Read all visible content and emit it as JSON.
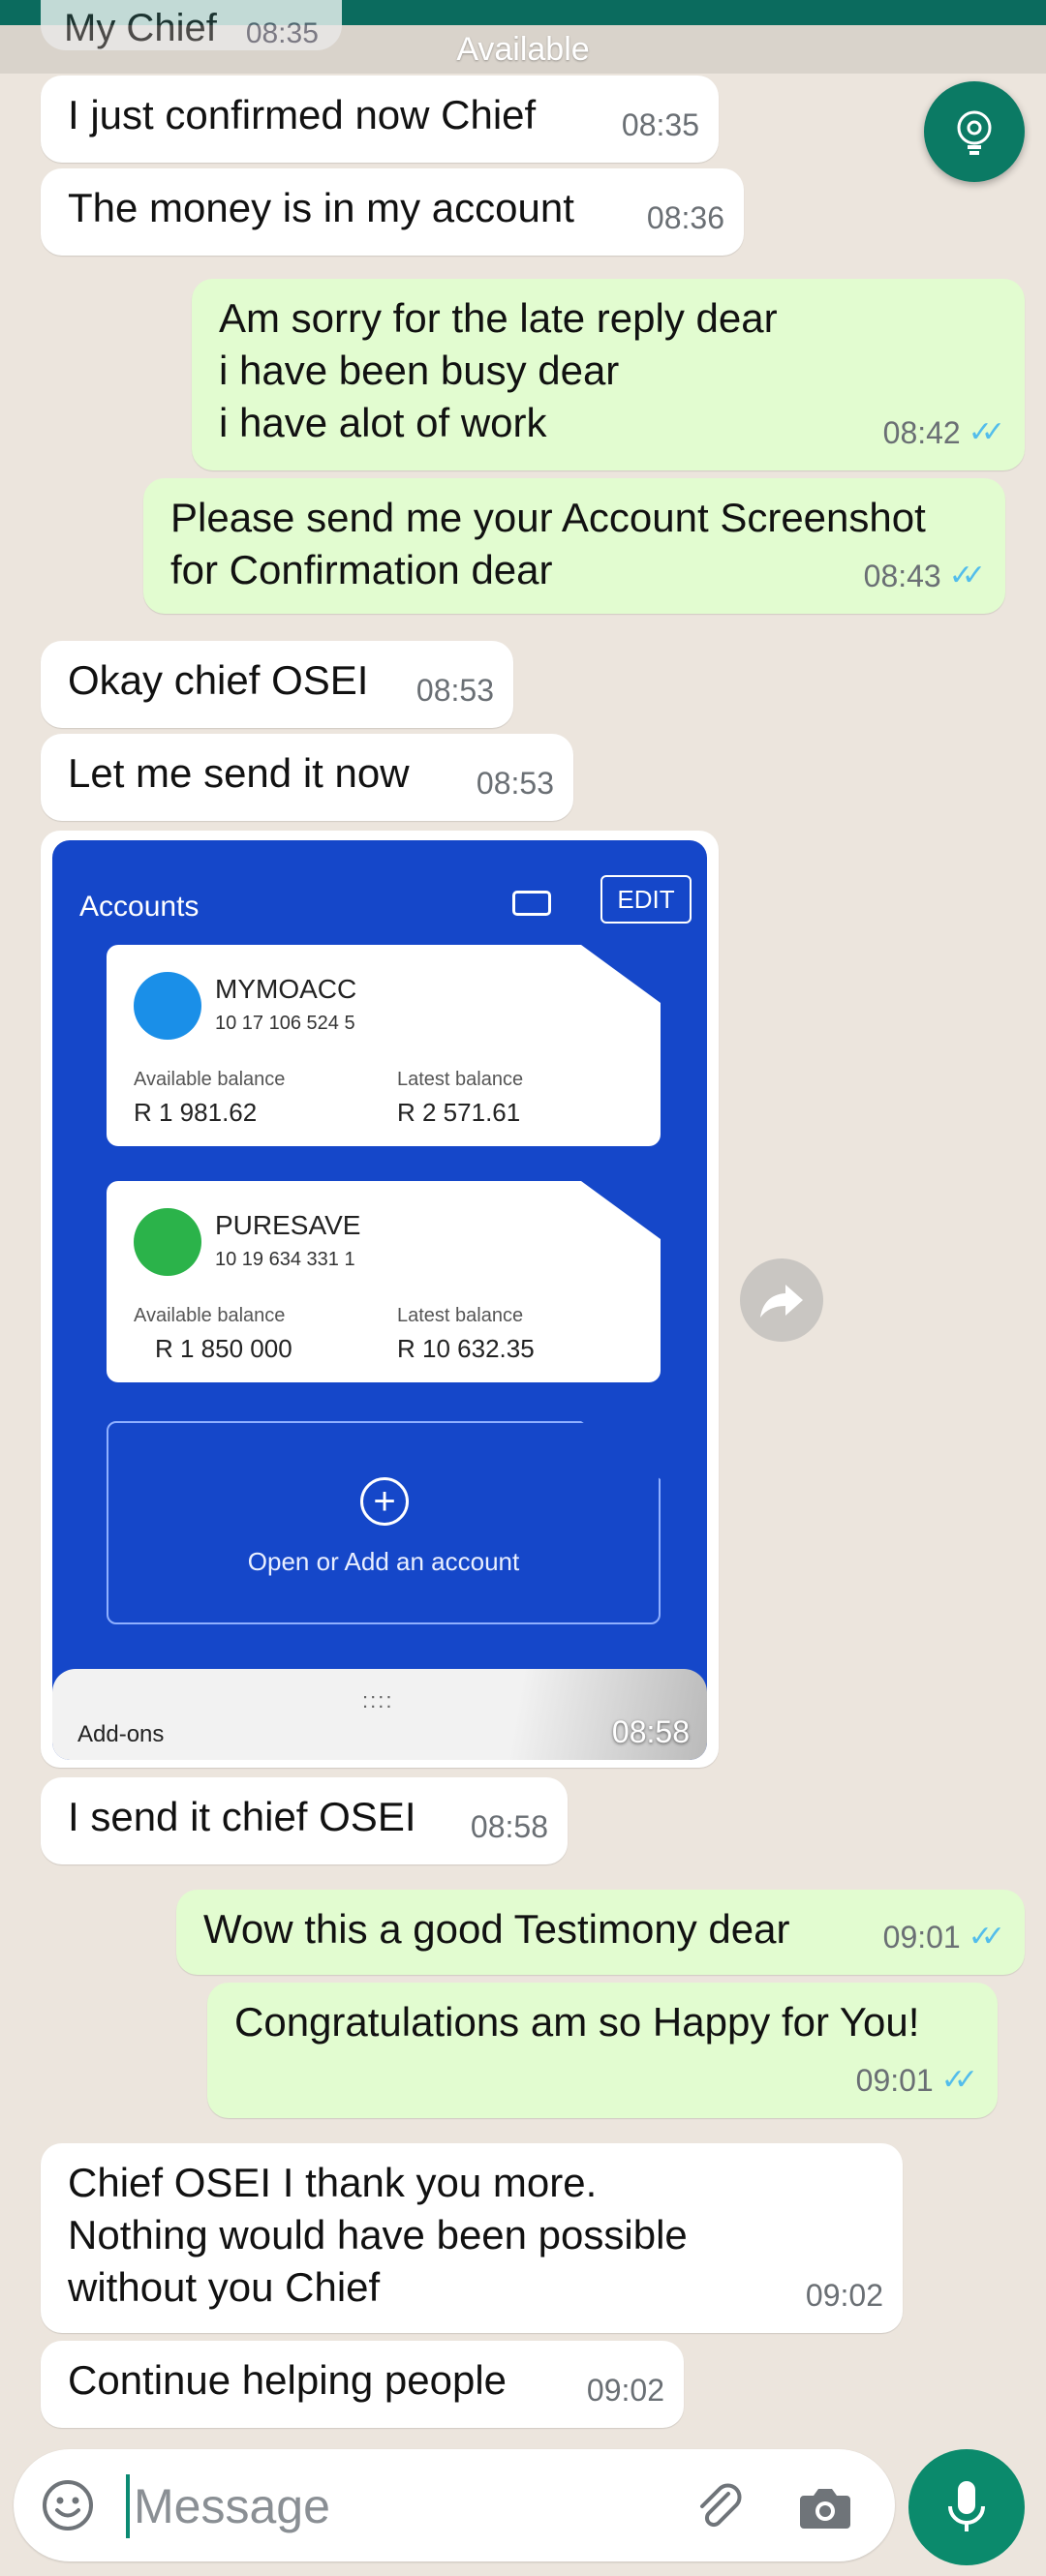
{
  "header": {
    "partial_name": "My Chief",
    "partial_time": "08:35",
    "status": "Available"
  },
  "messages": [
    {
      "dir": "in",
      "text": "I just confirmed now Chief",
      "time": "08:35"
    },
    {
      "dir": "in",
      "text": "The money is in my account",
      "time": "08:36"
    },
    {
      "dir": "out",
      "text": "Am sorry for the late reply dear\ni have been busy dear\ni have alot of work",
      "time": "08:42",
      "ticks": "✓✓"
    },
    {
      "dir": "out",
      "text": "Please send me your Account Screenshot\nfor Confirmation dear",
      "time": "08:43",
      "ticks": "✓✓"
    },
    {
      "dir": "in",
      "text": "Okay chief OSEI",
      "time": "08:53"
    },
    {
      "dir": "in",
      "text": "Let me send it now",
      "time": "08:53"
    },
    {
      "dir": "in",
      "text": "I send it chief OSEI",
      "time": "08:58"
    },
    {
      "dir": "out",
      "text": "Wow this a good Testimony dear",
      "time": "09:01",
      "ticks": "✓✓"
    },
    {
      "dir": "out",
      "text": "Congratulations am so Happy for You!",
      "time": "09:01",
      "ticks": "✓✓"
    },
    {
      "dir": "in",
      "text": "Chief OSEI I thank you more.\nNothing would have been possible\nwithout you Chief",
      "time": "09:02"
    },
    {
      "dir": "in",
      "text": "Continue helping people",
      "time": "09:02"
    }
  ],
  "image_message": {
    "time": "08:58",
    "screen": {
      "title": "Accounts",
      "edit_label": "EDIT",
      "accounts": [
        {
          "name": "MYMOACC",
          "number": "10 17 106 524 5",
          "avail_label": "Available balance",
          "avail": "R 1 981.62",
          "latest_label": "Latest balance",
          "latest": "R 2 571.61",
          "logo_color": "#1a8fe8"
        },
        {
          "name": "PURESAVE",
          "number": "10 19 634 331 1",
          "avail_label": "Available balance",
          "avail": "R 1 850 000",
          "latest_label": "Latest balance",
          "latest": "R 10 632.35",
          "logo_color": "#2bb34a"
        }
      ],
      "add_label": "Open or Add an account",
      "addons_label": "Add-ons",
      "dots": "::::"
    }
  },
  "composer": {
    "placeholder": "Message"
  },
  "icons": [
    "lightbulb-gear-icon",
    "share-forward-icon",
    "emoji-icon",
    "attach-icon",
    "camera-icon",
    "mic-icon"
  ],
  "colors": {
    "outgoing": "#e2fcd0",
    "incoming": "#ffffff",
    "accent": "#0b8a6c",
    "ticks": "#53bdeb",
    "wallpaper": "#ece5dd"
  }
}
